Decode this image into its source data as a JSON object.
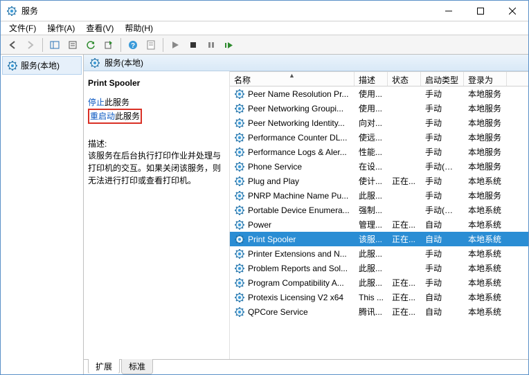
{
  "window": {
    "title": "服务"
  },
  "menu": {
    "file": "文件(F)",
    "action": "操作(A)",
    "view": "查看(V)",
    "help": "帮助(H)"
  },
  "tree": {
    "root": "服务(本地)"
  },
  "right_header": "服务(本地)",
  "detail": {
    "selected_name": "Print Spooler",
    "action_stop_prefix": "停止",
    "action_stop_suffix": "此服务",
    "action_restart_prefix": "重启动",
    "action_restart_suffix": "此服务",
    "desc_label": "描述:",
    "desc_text": "该服务在后台执行打印作业并处理与打印机的交互。如果关闭该服务，则无法进行打印或查看打印机。"
  },
  "columns": {
    "name": "名称",
    "desc": "描述",
    "status": "状态",
    "startup": "启动类型",
    "logon": "登录为"
  },
  "tabs": {
    "extended": "扩展",
    "standard": "标准"
  },
  "services": [
    {
      "name": "Peer Name Resolution Pr...",
      "desc": "使用...",
      "status": "",
      "startup": "手动",
      "logon": "本地服务"
    },
    {
      "name": "Peer Networking Groupi...",
      "desc": "使用...",
      "status": "",
      "startup": "手动",
      "logon": "本地服务"
    },
    {
      "name": "Peer Networking Identity...",
      "desc": "向对...",
      "status": "",
      "startup": "手动",
      "logon": "本地服务"
    },
    {
      "name": "Performance Counter DL...",
      "desc": "使远...",
      "status": "",
      "startup": "手动",
      "logon": "本地服务"
    },
    {
      "name": "Performance Logs & Aler...",
      "desc": "性能...",
      "status": "",
      "startup": "手动",
      "logon": "本地服务"
    },
    {
      "name": "Phone Service",
      "desc": "在设...",
      "status": "",
      "startup": "手动(触发...",
      "logon": "本地服务"
    },
    {
      "name": "Plug and Play",
      "desc": "使计...",
      "status": "正在...",
      "startup": "手动",
      "logon": "本地系统"
    },
    {
      "name": "PNRP Machine Name Pu...",
      "desc": "此服...",
      "status": "",
      "startup": "手动",
      "logon": "本地服务"
    },
    {
      "name": "Portable Device Enumera...",
      "desc": "强制...",
      "status": "",
      "startup": "手动(触发...",
      "logon": "本地系统"
    },
    {
      "name": "Power",
      "desc": "管理...",
      "status": "正在...",
      "startup": "自动",
      "logon": "本地系统"
    },
    {
      "name": "Print Spooler",
      "desc": "该服...",
      "status": "正在...",
      "startup": "自动",
      "logon": "本地系统",
      "selected": true
    },
    {
      "name": "Printer Extensions and N...",
      "desc": "此服...",
      "status": "",
      "startup": "手动",
      "logon": "本地系统"
    },
    {
      "name": "Problem Reports and Sol...",
      "desc": "此服...",
      "status": "",
      "startup": "手动",
      "logon": "本地系统"
    },
    {
      "name": "Program Compatibility A...",
      "desc": "此服...",
      "status": "正在...",
      "startup": "手动",
      "logon": "本地系统"
    },
    {
      "name": "Protexis Licensing V2 x64",
      "desc": "This ...",
      "status": "正在...",
      "startup": "自动",
      "logon": "本地系统"
    },
    {
      "name": "QPCore Service",
      "desc": "腾讯...",
      "status": "正在...",
      "startup": "自动",
      "logon": "本地系统"
    }
  ],
  "icon": {
    "gear_color": "#3a9ad9",
    "gear_stroke": "#1b6fa8"
  }
}
